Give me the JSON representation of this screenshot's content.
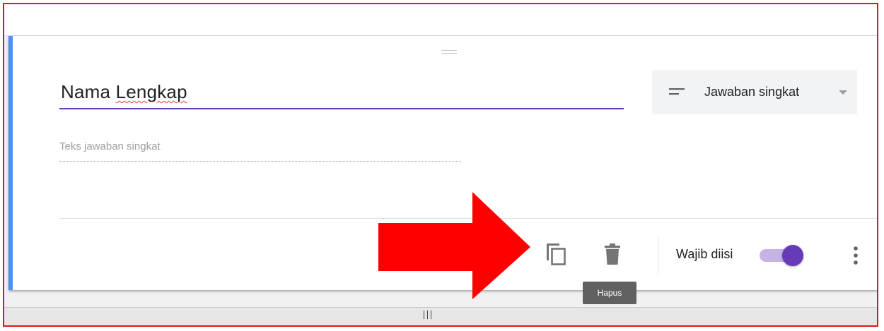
{
  "question": {
    "title_word1": "Nama",
    "title_word2": "Lengkap",
    "answer_hint": "Teks jawaban singkat"
  },
  "question_type": {
    "label": "Jawaban singkat",
    "icon": "short-answer-icon"
  },
  "footer": {
    "copy_icon": "content-copy-icon",
    "delete_icon": "trash-icon",
    "required_label": "Wajib diisi",
    "required_on": true,
    "more_icon": "more-vert-icon",
    "tooltip": "Hapus"
  },
  "annotation": {
    "arrow_color": "#ff0000",
    "frame_color": "#e0161b"
  },
  "colors": {
    "accent_bar": "#4d90fe",
    "primary": "#673ab7",
    "toggle_track": "#c5b3e6"
  }
}
